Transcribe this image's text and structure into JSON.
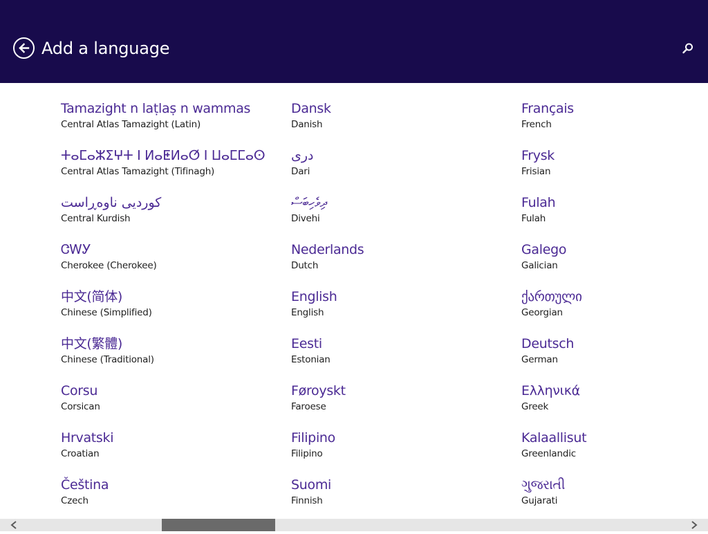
{
  "header": {
    "title": "Add a language",
    "back_icon": "back-arrow-icon",
    "search_icon": "search-icon",
    "background_color": "#180b4c"
  },
  "colors": {
    "native_name": "#4b2a94",
    "english_name": "#1f1f1f",
    "scrollbar_track": "#e6e6e6",
    "scrollbar_thumb": "#6a6a6a"
  },
  "columns": [
    [
      {
        "native": "Tamazight n laṭlaṣ n wammas",
        "english": "Central Atlas Tamazight (Latin)"
      },
      {
        "native": "ⵜⴰⵎⴰⵣⵉⵖⵜ ⵏ ⵍⴰⵟⵍⴰⵚ ⵏ ⵡⴰⵎⵎⴰⵙ",
        "english": "Central Atlas Tamazight (Tifinagh)"
      },
      {
        "native": "کوردیی ناوەڕاست",
        "english": "Central Kurdish"
      },
      {
        "native": "ᏣᎳᎩ",
        "english": "Cherokee (Cherokee)"
      },
      {
        "native": "中文(简体)",
        "english": "Chinese (Simplified)"
      },
      {
        "native": "中文(繁體)",
        "english": "Chinese (Traditional)"
      },
      {
        "native": "Corsu",
        "english": "Corsican"
      },
      {
        "native": "Hrvatski",
        "english": "Croatian"
      },
      {
        "native": "Čeština",
        "english": "Czech"
      }
    ],
    [
      {
        "native": "Dansk",
        "english": "Danish"
      },
      {
        "native": "درى",
        "english": "Dari"
      },
      {
        "native": "ދިވެހިބަސް",
        "english": "Divehi"
      },
      {
        "native": "Nederlands",
        "english": "Dutch"
      },
      {
        "native": "English",
        "english": "English"
      },
      {
        "native": "Eesti",
        "english": "Estonian"
      },
      {
        "native": "Føroyskt",
        "english": "Faroese"
      },
      {
        "native": "Filipino",
        "english": "Filipino"
      },
      {
        "native": "Suomi",
        "english": "Finnish"
      }
    ],
    [
      {
        "native": "Français",
        "english": "French"
      },
      {
        "native": "Frysk",
        "english": "Frisian"
      },
      {
        "native": "Fulah",
        "english": "Fulah"
      },
      {
        "native": "Galego",
        "english": "Galician"
      },
      {
        "native": "ქართული",
        "english": "Georgian"
      },
      {
        "native": "Deutsch",
        "english": "German"
      },
      {
        "native": "Ελληνικά",
        "english": "Greek"
      },
      {
        "native": "Kalaallisut",
        "english": "Greenlandic"
      },
      {
        "native": "ગુજરાતી",
        "english": "Gujarati"
      }
    ]
  ],
  "scrollbar": {
    "left_icon": "chevron-left-icon",
    "right_icon": "chevron-right-icon",
    "position_fraction": 0.23
  }
}
